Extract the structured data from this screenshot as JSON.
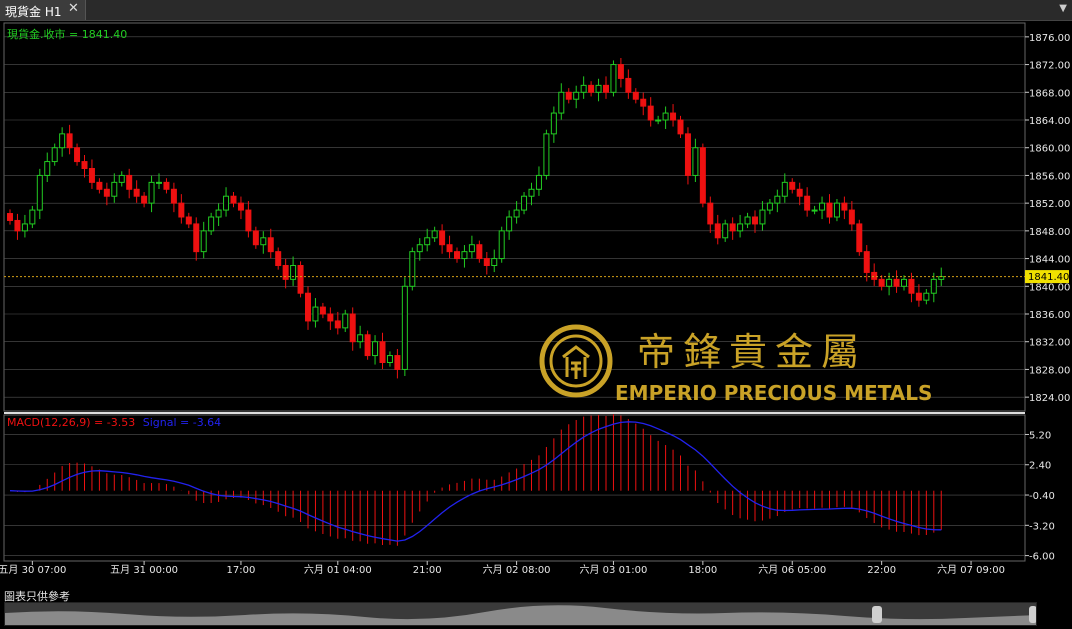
{
  "tab": {
    "title": "現貨金 H1",
    "close": "✕",
    "menu": "▼"
  },
  "footer": {
    "note": "圖表只供參考"
  },
  "logo": {
    "chinese": "帝鋒貴金屬",
    "english": "EMPERIO PRECIOUS METALS"
  },
  "colors": {
    "up": "#22cc22",
    "down": "#ee1111",
    "macd_hist": "#ee1111",
    "signal": "#2222ee",
    "grid": "#555555",
    "price_line": "#d4a017",
    "gold": "#c9a227"
  },
  "chart_data": [
    {
      "type": "candlestick",
      "title": "現貨金.收市 = 1841.40",
      "last_price": 1841.4,
      "last_price_label": "1841.40",
      "ylim": [
        1822,
        1878
      ],
      "yticks": [
        1876,
        1872,
        1868,
        1864,
        1860,
        1856,
        1852,
        1848,
        1844,
        1840,
        1836,
        1832,
        1828,
        1824
      ],
      "ytick_labels": [
        "1876.00",
        "1872.00",
        "1868.00",
        "1864.00",
        "1860.00",
        "1856.00",
        "1852.00",
        "1848.00",
        "1844.00",
        "1840.00",
        "1836.00",
        "1832.00",
        "1828.00",
        "1824.00"
      ],
      "grid": true,
      "closes": [
        1849.5,
        1848,
        1849,
        1851,
        1856,
        1858,
        1860,
        1862,
        1860,
        1858,
        1857,
        1855,
        1854,
        1853,
        1855,
        1856,
        1854,
        1853,
        1852,
        1855,
        1855,
        1854,
        1852,
        1850,
        1849,
        1845,
        1848,
        1850,
        1851,
        1853,
        1852,
        1851,
        1848,
        1846,
        1847,
        1845,
        1843,
        1841,
        1843,
        1839,
        1835,
        1837,
        1836,
        1835,
        1834,
        1836,
        1832,
        1833,
        1830,
        1832,
        1829,
        1830,
        1828,
        1840,
        1845,
        1846,
        1847,
        1848,
        1846,
        1845,
        1844,
        1845,
        1846,
        1844,
        1843,
        1844,
        1848,
        1850,
        1851,
        1853,
        1854,
        1856,
        1862,
        1865,
        1868,
        1867,
        1868,
        1869,
        1868,
        1869,
        1868,
        1872,
        1870,
        1868,
        1867,
        1866,
        1864,
        1864,
        1865,
        1864,
        1862,
        1856,
        1860,
        1852,
        1849,
        1847,
        1849,
        1848,
        1849,
        1850,
        1849,
        1851,
        1852,
        1853,
        1855,
        1854,
        1853,
        1851,
        1851,
        1852,
        1850,
        1852,
        1851,
        1849,
        1845,
        1842,
        1841,
        1840,
        1841,
        1840,
        1841,
        1839,
        1838,
        1839,
        1841,
        1841.4
      ],
      "x_tick_labels": [
        "五月 30 07:00",
        "五月 31 00:00",
        "17:00",
        "六月 01 04:00",
        "21:00",
        "六月 02 08:00",
        "六月 03 01:00",
        "18:00",
        "六月 06 05:00",
        "22:00",
        "六月 07 09:00"
      ],
      "x_tick_index": [
        3,
        18,
        31,
        44,
        56,
        68,
        81,
        93,
        105,
        117,
        129
      ]
    },
    {
      "type": "bar+line",
      "title": "MACD(12,26,9) = -3.53",
      "signal_label": "Signal = -3.64",
      "macd_value": -3.53,
      "signal_value": -3.64,
      "ylim": [
        -6.5,
        7.0
      ],
      "yticks": [
        5.2,
        2.4,
        -0.4,
        -3.2,
        -6.0
      ],
      "ytick_labels": [
        "5.20",
        "2.40",
        "-0.40",
        "-3.20",
        "-6.00"
      ],
      "grid": true
    }
  ]
}
